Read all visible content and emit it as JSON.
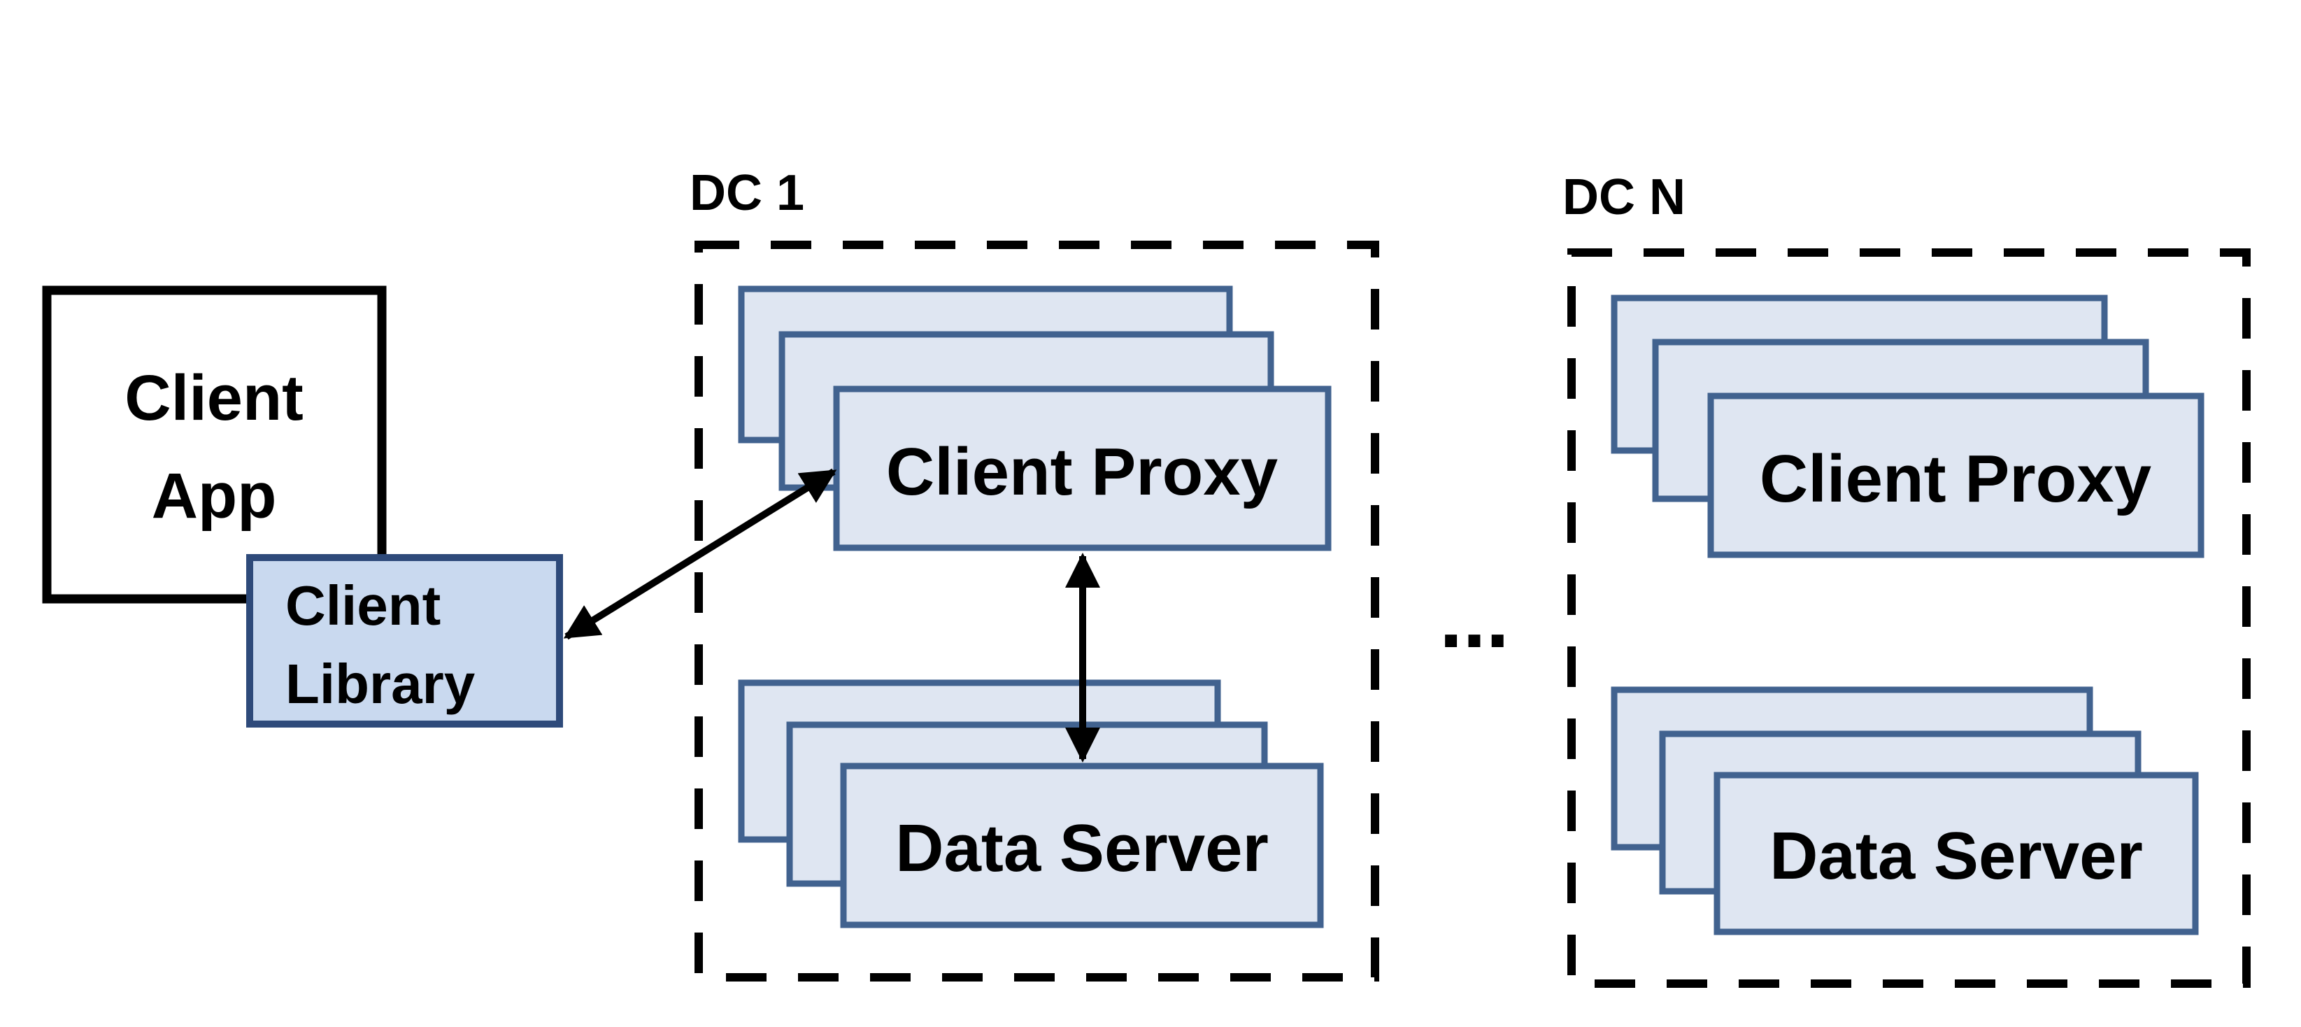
{
  "client_app": {
    "label_line1": "Client",
    "label_line2": "App"
  },
  "client_library": {
    "label_line1": "Client",
    "label_line2": "Library"
  },
  "datacenters": [
    {
      "label": "DC 1",
      "proxy_label": "Client Proxy",
      "server_label": "Data Server"
    },
    {
      "label": "DC N",
      "proxy_label": "Client Proxy",
      "server_label": "Data Server"
    }
  ],
  "ellipsis": "...",
  "colors": {
    "component_fill": "#dfe6f2",
    "component_stroke": "#41628f",
    "library_fill": "#c9d9ef",
    "library_stroke": "#2e4a7a",
    "line": "#000000"
  }
}
